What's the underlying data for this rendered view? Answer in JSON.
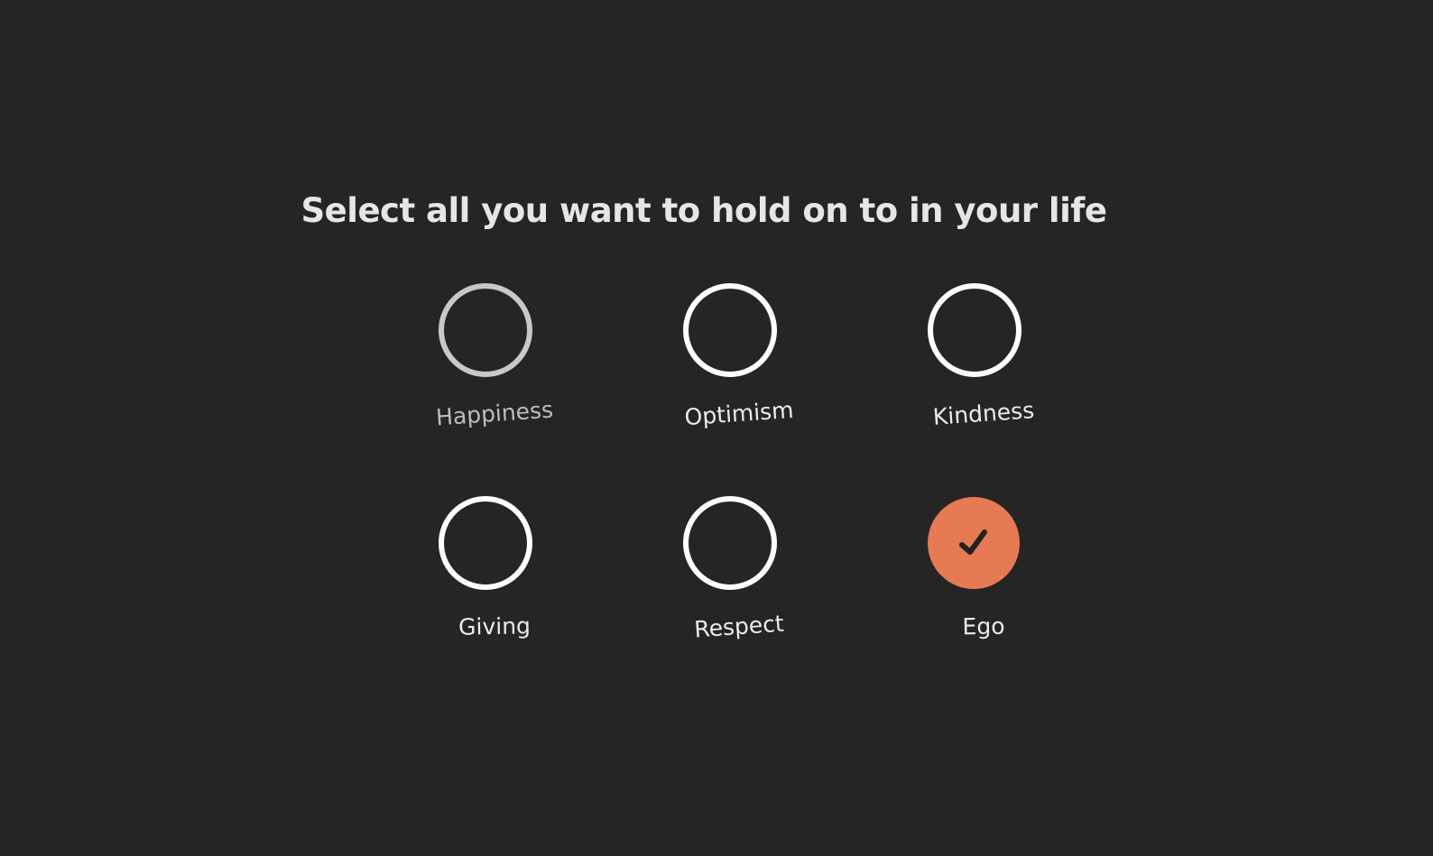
{
  "page": {
    "heading": "Select all you want to hold on to in your life",
    "background_color": "#252525",
    "accent_color": "#e67a52"
  },
  "options": [
    {
      "label": "Happiness",
      "checked": false,
      "dimmed": true
    },
    {
      "label": "Optimism",
      "checked": false,
      "dimmed": false
    },
    {
      "label": "Kindness",
      "checked": false,
      "dimmed": false
    },
    {
      "label": "Giving",
      "checked": false,
      "dimmed": false
    },
    {
      "label": "Respect",
      "checked": false,
      "dimmed": false
    },
    {
      "label": "Ego",
      "checked": true,
      "dimmed": false,
      "icon": "checkmark-icon"
    }
  ]
}
